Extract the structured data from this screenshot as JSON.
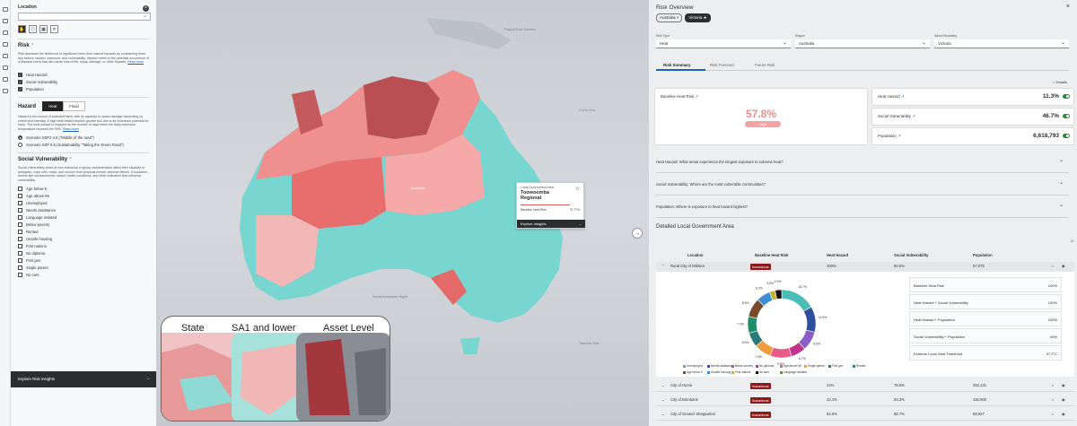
{
  "left_panel": {
    "location_label": "Location",
    "risk": {
      "title": "Risk",
      "description": "Risk assesses the likelihood of significant harm from natural hazards by considering three key factors: hazard, exposure, and vulnerability. Hazard refers to the potential occurrence of a physical event that can cause loss of life, injury, damage, or other impacts.",
      "read_more": "Read more",
      "checks": [
        {
          "label": "Heat Hazard",
          "checked": true
        },
        {
          "label": "Social Vulnerability",
          "checked": true
        },
        {
          "label": "Population",
          "checked": true
        }
      ]
    },
    "hazard": {
      "title": "Hazard",
      "tabs": [
        "Heat",
        "Flood"
      ],
      "active_tab": "Heat",
      "description": "Hazard is the source of potential harm, with its capacity to cause damage depending on extent and intensity. A high heat hazard implies greater risk due to its increased potential for harm. The heat hazard is mapped as the number of days when the daily maximum temperature exceeds the 99%.",
      "read_more": "Read more",
      "scenarios": [
        {
          "label": "Scenario SSP2 4.5 (\"Middle of the road\")",
          "selected": true
        },
        {
          "label": "Scenario SSP 8.5 (Sustainability \"Taking the Green Road\")",
          "selected": false
        }
      ]
    },
    "social": {
      "title": "Social Vulnerability",
      "description": "Social vulnerability looks at how individual or group characteristics affect their capacity to anticipate, cope with, resist, and recover from physical events' adverse effects. It considers factors like socioeconomic status, health conditions, and other indicators that influence vulnerability.",
      "items": [
        "Age below 5",
        "Age above 65",
        "Unemployed",
        "Needs assistance",
        "Language isolated",
        "Below poverty",
        "Rented",
        "Unsafe housing",
        "First nations",
        "No diploma",
        "First gen",
        "Single parent",
        "No cars"
      ]
    },
    "explore_label": "Explore Risk Insights"
  },
  "map": {
    "labels": [
      "Papua New Guinea",
      "Australia",
      "Great Australian Bight",
      "Tasman Sea",
      "Coral Sea"
    ],
    "tooltip": {
      "subtitle": "Local Government Area",
      "name": "Toowoomba Regional",
      "metric_label": "Baseline Heat Risk",
      "metric_value": "79.77%",
      "action": "Explore Insights"
    },
    "inset_titles": [
      "State",
      "SA1 and lower",
      "Asset Level"
    ]
  },
  "right_panel": {
    "title": "Risk Overview",
    "chips": [
      "Australia",
      "Victoria"
    ],
    "filters": [
      {
        "label": "Risk Type",
        "value": "Heat"
      },
      {
        "label": "Region",
        "value": "Australia"
      },
      {
        "label": "Admin Boundary",
        "value": "Victoria"
      }
    ],
    "tabs": [
      "Risk Summary",
      "Risk Forecast",
      "Future Risk"
    ],
    "active_tab": "Risk Summary",
    "details_label": "Details",
    "baseline": {
      "label": "Baseline Heat Risk",
      "value": "57.8%",
      "level": "high"
    },
    "metrics": [
      {
        "label": "Heat Hazard",
        "value": "11.3%"
      },
      {
        "label": "Social Vulnerability",
        "value": "46.7%"
      },
      {
        "label": "Population",
        "value": "6,618,793"
      }
    ],
    "questions": [
      "Heat Hazard: What areas experience the longest exposure to extreme heat?",
      "Social Vulnerability: Where are the most vulnerable communities?",
      "Population: Where is exposure to heat hazard highest?"
    ],
    "table_title": "Detailed Local Government Area",
    "columns": [
      "Location",
      "Baseline Heat Risk",
      "Heat Hazard",
      "Social Vulnerability",
      "Population"
    ],
    "rows": [
      {
        "location": "Rural City of Mildura",
        "risk": "hazardous",
        "hazard": "100%",
        "social": "92.6%",
        "pop": "57,075"
      },
      {
        "location": "City of Hume",
        "risk": "hazardous",
        "hazard": "21%",
        "social": "78.6%",
        "pop": "252,131"
      },
      {
        "location": "City of Brimbank",
        "risk": "hazardous",
        "hazard": "22.1%",
        "social": "93.3%",
        "pop": "192,900"
      },
      {
        "location": "City of Greater Shepparton",
        "risk": "hazardous",
        "hazard": "62.6%",
        "social": "86.7%",
        "pop": "68,937"
      }
    ],
    "combos": [
      {
        "label": "Baseline Heat Risk",
        "value": "100%"
      },
      {
        "label": "Heat Hazard + Social Vulnerability",
        "value": "100%"
      },
      {
        "label": "Heat Hazard + Population",
        "value": "100%"
      },
      {
        "label": "Social Vulnerability + Population",
        "value": "49%"
      },
      {
        "label": "Extreme Local Heat Threshold",
        "value": "37.2°C"
      }
    ],
    "donut_labels": [
      "15.7%",
      "11.5%",
      "8.6%",
      "6.7%",
      "9.5%",
      "7.6%",
      "6.5%",
      "7.4%",
      "8.5%",
      "6.2%",
      "2.6%",
      "2.9%"
    ],
    "legend": [
      "Unemployed",
      "Needs assistance",
      "Below poverty",
      "No diploma",
      "Age above 65",
      "Single parent",
      "First gen",
      "Rented",
      "Age below 5",
      "Unsafe housing",
      "First nations",
      "No cars",
      "Language isolated"
    ]
  },
  "colors": {
    "risk_red": "#e46a6a",
    "low_teal": "#6fd3cf",
    "dark": "#2b2d31",
    "link": "#1c63b7",
    "hazardous": "#8b1a1a"
  }
}
